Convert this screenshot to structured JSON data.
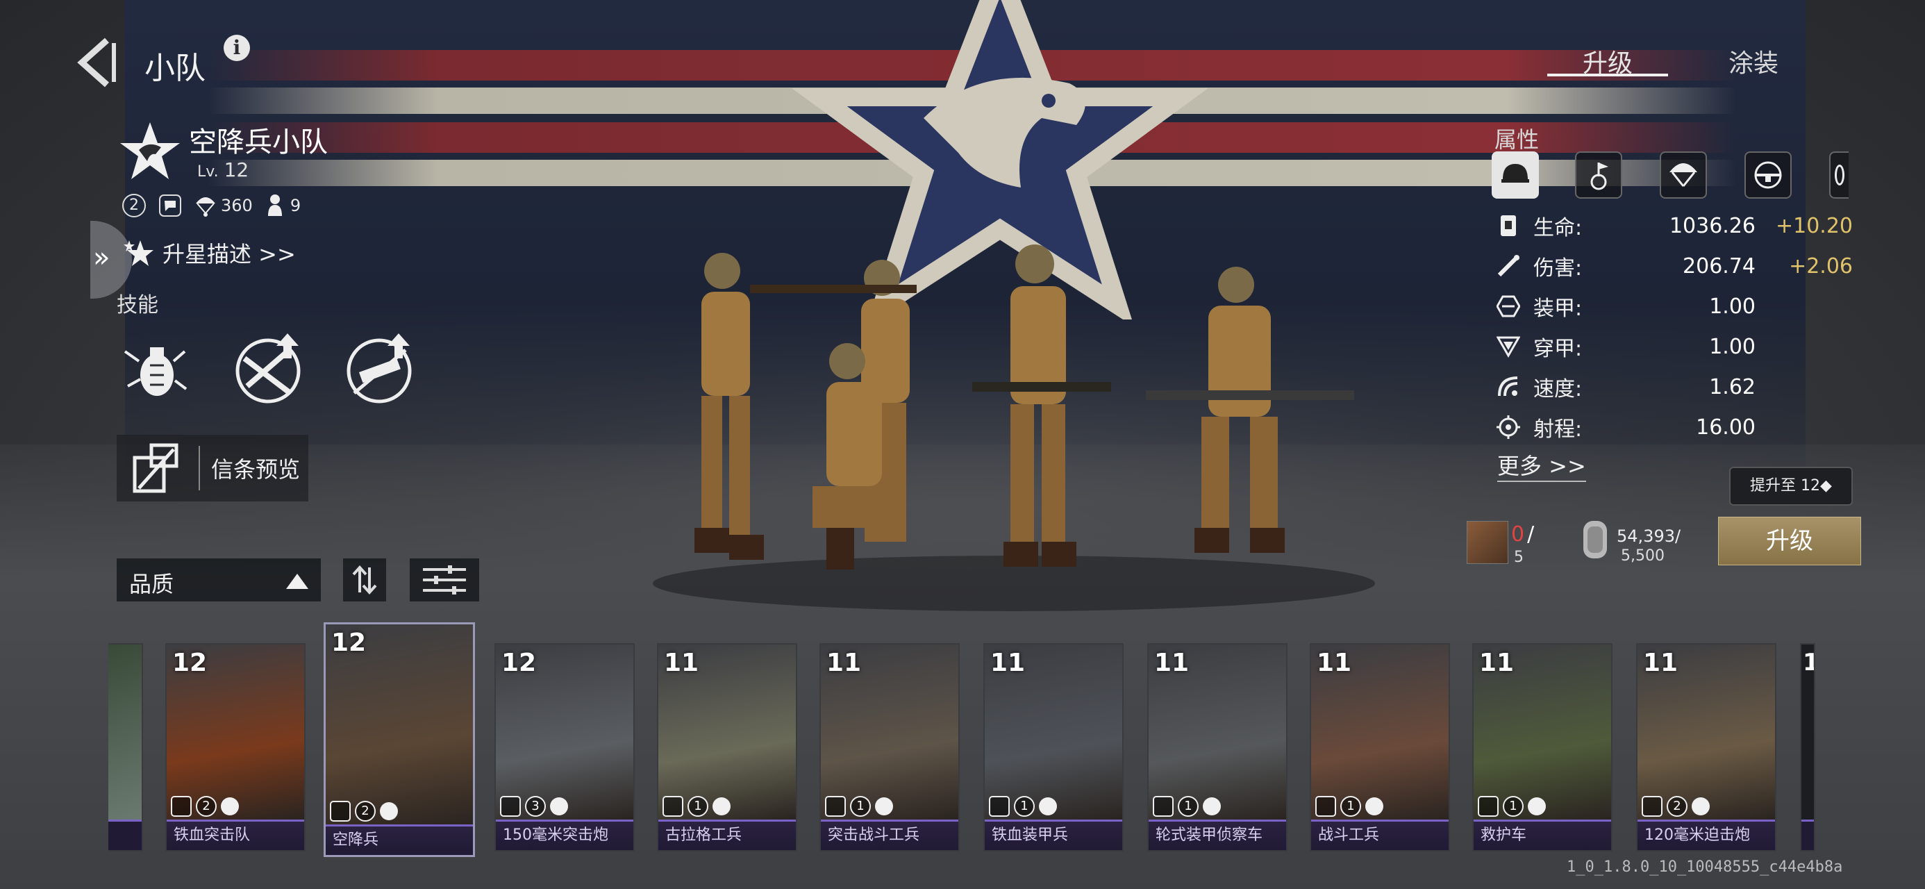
{
  "header": {
    "title": "小队",
    "info_icon": "i",
    "tabs": [
      {
        "label": "升级",
        "active": true
      },
      {
        "label": "涂装",
        "active": false
      }
    ]
  },
  "unit": {
    "name": "空降兵小队",
    "level_prefix": "Lv.",
    "level": "12",
    "tier": "2",
    "parachute_count": "360",
    "soldier_count": "9",
    "star_desc": "升星描述 >>",
    "skills_label": "技能",
    "skills": [
      "grenade-skill-icon",
      "rifle-upgrade-skill-icon",
      "weapon-upgrade-skill-icon"
    ],
    "preview_label": "信条预览"
  },
  "attributes": {
    "title": "属性",
    "tabs": [
      "helmet-icon",
      "commander-icon",
      "parachute-icon",
      "rifle-icon",
      "partial-tab-icon"
    ],
    "rows": [
      {
        "icon": "health-icon",
        "name": "生命:",
        "value": "1036.26",
        "bonus": "+10.20"
      },
      {
        "icon": "damage-icon",
        "name": "伤害:",
        "value": "206.74",
        "bonus": "+2.06"
      },
      {
        "icon": "armor-icon",
        "name": "装甲:",
        "value": "1.00",
        "bonus": ""
      },
      {
        "icon": "penetration-icon",
        "name": "穿甲:",
        "value": "1.00",
        "bonus": ""
      },
      {
        "icon": "speed-icon",
        "name": "速度:",
        "value": "1.62",
        "bonus": ""
      },
      {
        "icon": "range-icon",
        "name": "射程:",
        "value": "16.00",
        "bonus": ""
      }
    ],
    "more_label": "更多 >>"
  },
  "upgrade": {
    "tooltip": "提升至 12◆",
    "card_have": "0",
    "card_slash": "/",
    "card_need": "5",
    "resource_have": "54,393/",
    "resource_need": "5,500",
    "button_label": "升级"
  },
  "filters": {
    "quality_label": "品质"
  },
  "cards": [
    {
      "level": "12",
      "name": "铁血突击队",
      "count": "2",
      "selected": false,
      "art": "#7a3a1c"
    },
    {
      "level": "12",
      "name": "空降兵",
      "count": "2",
      "selected": true,
      "art": "#5a4634"
    },
    {
      "level": "12",
      "name": "150毫米突击炮",
      "count": "3",
      "selected": false,
      "art": "#5a5e62"
    },
    {
      "level": "11",
      "name": "古拉格工兵",
      "count": "1",
      "selected": false,
      "art": "#6a6a58"
    },
    {
      "level": "11",
      "name": "突击战斗工兵",
      "count": "1",
      "selected": false,
      "art": "#5e5448"
    },
    {
      "level": "11",
      "name": "铁血装甲兵",
      "count": "1",
      "selected": false,
      "art": "#4e5258"
    },
    {
      "level": "11",
      "name": "轮式装甲侦察车",
      "count": "1",
      "selected": false,
      "art": "#55585a"
    },
    {
      "level": "11",
      "name": "战斗工兵",
      "count": "1",
      "selected": false,
      "art": "#6a4a3a"
    },
    {
      "level": "11",
      "name": "救护车",
      "count": "1",
      "selected": false,
      "art": "#4e5a3a"
    },
    {
      "level": "11",
      "name": "120毫米迫击炮",
      "count": "2",
      "selected": false,
      "art": "#6a5a44"
    }
  ],
  "edge_card_level": "1",
  "version": "1_0_1.8.0_10_10048555_c44e4b8a",
  "colors": {
    "accent_gold": "#e0c36a",
    "cost_red": "#e04444",
    "card_name_bar": "#7b62c6",
    "upgrade_button": "#a89368"
  }
}
